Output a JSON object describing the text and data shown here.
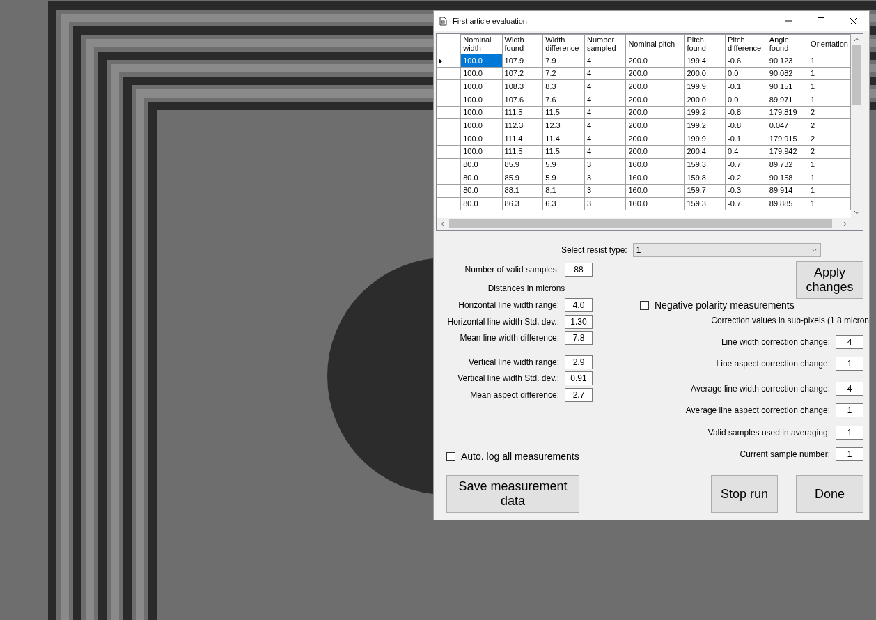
{
  "window": {
    "title": "First article evaluation"
  },
  "table": {
    "columns": [
      "Nominal width",
      "Width found",
      "Width difference",
      "Number sampled",
      "Nominal pitch",
      "Pitch found",
      "Pitch difference",
      "Angle found",
      "Orientation"
    ],
    "rows": [
      {
        "selected": true,
        "cells": [
          "100.0",
          "107.9",
          "7.9",
          "4",
          "200.0",
          "199.4",
          "-0.6",
          "90.123",
          "1"
        ]
      },
      {
        "selected": false,
        "cells": [
          "100.0",
          "107.2",
          "7.2",
          "4",
          "200.0",
          "200.0",
          "0.0",
          "90.082",
          "1"
        ]
      },
      {
        "selected": false,
        "cells": [
          "100.0",
          "108.3",
          "8.3",
          "4",
          "200.0",
          "199.9",
          "-0.1",
          "90.151",
          "1"
        ]
      },
      {
        "selected": false,
        "cells": [
          "100.0",
          "107.6",
          "7.6",
          "4",
          "200.0",
          "200.0",
          "0.0",
          "89.971",
          "1"
        ]
      },
      {
        "selected": false,
        "cells": [
          "100.0",
          "111.5",
          "11.5",
          "4",
          "200.0",
          "199.2",
          "-0.8",
          "179.819",
          "2"
        ]
      },
      {
        "selected": false,
        "cells": [
          "100.0",
          "112.3",
          "12.3",
          "4",
          "200.0",
          "199.2",
          "-0.8",
          "0.047",
          "2"
        ]
      },
      {
        "selected": false,
        "cells": [
          "100.0",
          "111.4",
          "11.4",
          "4",
          "200.0",
          "199.9",
          "-0.1",
          "179.915",
          "2"
        ]
      },
      {
        "selected": false,
        "cells": [
          "100.0",
          "111.5",
          "11.5",
          "4",
          "200.0",
          "200.4",
          "0.4",
          "179.942",
          "2"
        ]
      },
      {
        "selected": false,
        "cells": [
          "80.0",
          "85.9",
          "5.9",
          "3",
          "160.0",
          "159.3",
          "-0.7",
          "89.732",
          "1"
        ]
      },
      {
        "selected": false,
        "cells": [
          "80.0",
          "85.9",
          "5.9",
          "3",
          "160.0",
          "159.8",
          "-0.2",
          "90.158",
          "1"
        ]
      },
      {
        "selected": false,
        "cells": [
          "80.0",
          "88.1",
          "8.1",
          "3",
          "160.0",
          "159.7",
          "-0.3",
          "89.914",
          "1"
        ]
      },
      {
        "selected": false,
        "cells": [
          "80.0",
          "86.3",
          "6.3",
          "3",
          "160.0",
          "159.3",
          "-0.7",
          "89.885",
          "1"
        ]
      }
    ]
  },
  "resist_type": {
    "label": "Select resist type:",
    "value": "1"
  },
  "valid_samples": {
    "label": "Number of valid samples:",
    "value": "88"
  },
  "distances_caption": "Distances in microns",
  "horizontal_fields": [
    {
      "label": "Horizontal line width range:",
      "value": "4.0"
    },
    {
      "label": "Horizontal line width Std. dev.:",
      "value": "1.30"
    },
    {
      "label": "Mean line width difference:",
      "value": "7.8"
    }
  ],
  "vertical_fields": [
    {
      "label": "Vertical line width range:",
      "value": "2.9"
    },
    {
      "label": "Vertical line width Std. dev.:",
      "value": "0.91"
    },
    {
      "label": "Mean aspect difference:",
      "value": "2.7"
    }
  ],
  "apply_button": "Apply changes",
  "negative_polarity": {
    "label": "Negative polarity measurements",
    "checked": false
  },
  "correction_caption": "Correction values in sub-pixels (1.8 micron",
  "correction_fields": [
    {
      "label": "Line width correction change:",
      "value": "4"
    },
    {
      "label": "Line aspect correction change:",
      "value": "1"
    },
    {
      "label": "Average line width correction change:",
      "value": "4"
    },
    {
      "label": "Average line aspect correction change:",
      "value": "1"
    },
    {
      "label": "Valid samples used in averaging:",
      "value": "1"
    },
    {
      "label": "Current sample number:",
      "value": "1"
    }
  ],
  "auto_log": {
    "label": "Auto. log all measurements",
    "checked": false
  },
  "save_button": "Save measurement data",
  "stop_button": "Stop run",
  "done_button": "Done"
}
